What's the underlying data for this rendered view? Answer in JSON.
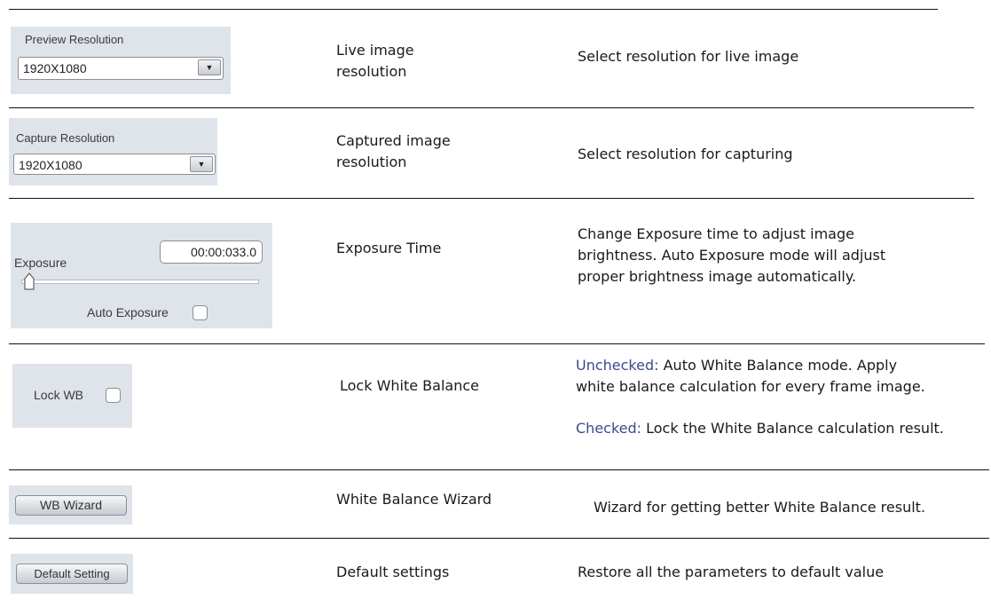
{
  "rows": [
    {
      "widget": {
        "caption": "Preview Resolution",
        "value": "1920X1080",
        "arrow": "▼"
      },
      "feature": [
        "Live image",
        "resolution"
      ],
      "description": "Select resolution for live image"
    },
    {
      "widget": {
        "caption": "Capture Resolution",
        "value": "1920X1080",
        "arrow": "▼"
      },
      "feature": [
        "Captured image",
        "resolution"
      ],
      "description": "Select resolution for capturing"
    },
    {
      "widget": {
        "caption": "Exposure",
        "time_value": "00:00:033.0",
        "auto_label": "Auto Exposure"
      },
      "feature": [
        "Exposure Time"
      ],
      "description": [
        "Change Exposure time to adjust image",
        "brightness. Auto Exposure mode will adjust",
        "proper brightness image automatically."
      ]
    },
    {
      "widget": {
        "label": "Lock WB"
      },
      "feature": [
        "Lock White Balance"
      ],
      "description": {
        "unchecked_key": "Unchecked:",
        "unchecked_text_1": " Auto White Balance mode. Apply",
        "unchecked_text_2": "white balance calculation for every frame image.",
        "checked_key": "Checked:",
        "checked_text": " Lock the White Balance calculation result."
      }
    },
    {
      "widget": {
        "button_label": "WB Wizard"
      },
      "feature": [
        "White Balance Wizard"
      ],
      "description": "Wizard for getting better White Balance result."
    },
    {
      "widget": {
        "button_label": "Default Setting"
      },
      "feature": [
        "Default settings"
      ],
      "description": "Restore all the parameters to default value"
    }
  ],
  "colors": {
    "keyword": "#3b4a8c",
    "panel": "#dfe3ea",
    "rule": "#111111"
  }
}
